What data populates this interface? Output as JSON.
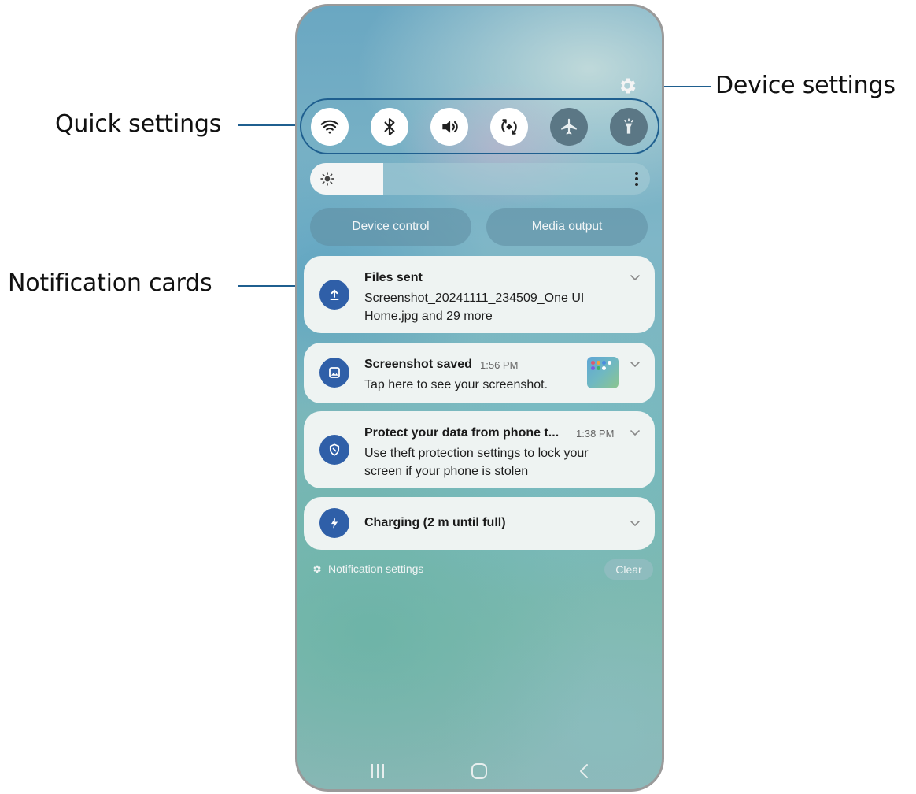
{
  "callouts": {
    "quick_settings": "Quick settings",
    "device_settings": "Device settings",
    "notification_cards": "Notification cards"
  },
  "quick_settings": [
    {
      "name": "wifi",
      "icon": "wifi-icon",
      "state": "on"
    },
    {
      "name": "bluetooth",
      "icon": "bluetooth-icon",
      "state": "on"
    },
    {
      "name": "sound",
      "icon": "volume-icon",
      "state": "on"
    },
    {
      "name": "auto_rotate",
      "icon": "rotate-icon",
      "state": "on"
    },
    {
      "name": "airplane_mode",
      "icon": "airplane-icon",
      "state": "off"
    },
    {
      "name": "flashlight",
      "icon": "flashlight-icon",
      "state": "off"
    }
  ],
  "brightness": {
    "level": 0.22,
    "icon": "sun-icon"
  },
  "controls": {
    "device_control": "Device control",
    "media_output": "Media output"
  },
  "notifications": [
    {
      "icon": "upload-icon",
      "title": "Files sent",
      "time": "",
      "body_line1": "Screenshot_20241111_234509_One UI",
      "body_line2": "Home.jpg and 29 more"
    },
    {
      "icon": "image-icon",
      "title": "Screenshot saved",
      "time": "1:56 PM",
      "body_line1": "Tap here to see your screenshot.",
      "has_thumbnail": true
    },
    {
      "icon": "shield-icon",
      "title": "Protect your data from phone t...",
      "time": "1:38 PM",
      "body_line1": "Use theft protection settings to lock your",
      "body_line2": "screen if your phone is stolen"
    },
    {
      "icon": "bolt-icon",
      "title": "Charging (2 m until full)",
      "time": ""
    }
  ],
  "footer": {
    "notification_settings": "Notification settings",
    "clear": "Clear"
  },
  "colors": {
    "callout_line": "#1f5f8f",
    "notification_icon_bg": "#2f5fa8",
    "card_bg": "#eef3f2"
  }
}
